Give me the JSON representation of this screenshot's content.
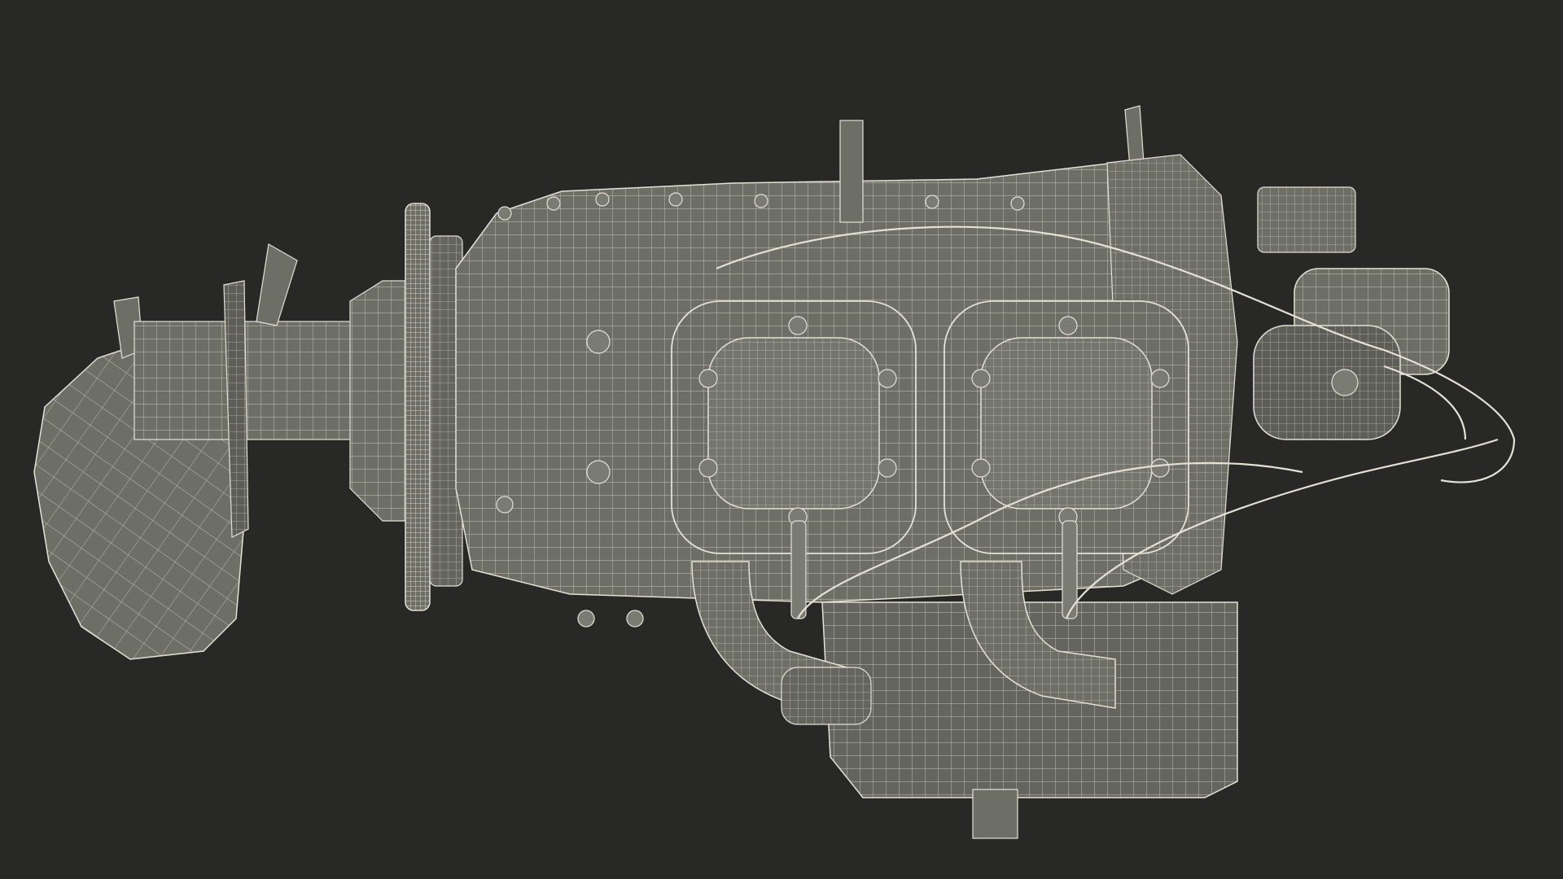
{
  "scene": {
    "background_color": "#282826",
    "model_fill_color": "#6d6e66",
    "model_shadow_color": "#4d4e48",
    "wire_color": "#e4e2d6"
  }
}
